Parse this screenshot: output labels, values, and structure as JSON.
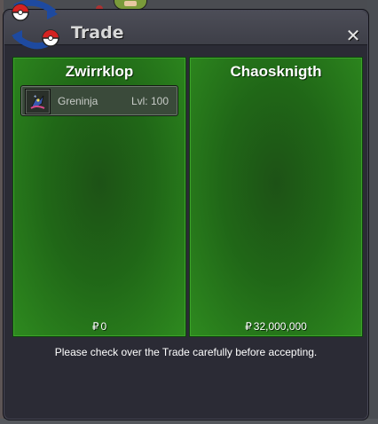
{
  "window": {
    "title": "Trade",
    "close_glyph": "✕",
    "logo_icon": "pokeball-exchange-icon"
  },
  "left_panel": {
    "player_name": "Zwirrklop",
    "items": [
      {
        "icon": "greninja-sprite-icon",
        "name": "Greninja",
        "level": "Lvl: 100"
      }
    ],
    "currency_symbol": "₽",
    "money": "0"
  },
  "right_panel": {
    "player_name": "Chaosknigth",
    "items": [],
    "currency_symbol": "₽",
    "money": "32,000,000"
  },
  "notice": "Please check over the Trade carefully before accepting.",
  "colors": {
    "panel_green": "#206717",
    "window_bg": "#2b2b35",
    "titlebar": "#45464f"
  }
}
